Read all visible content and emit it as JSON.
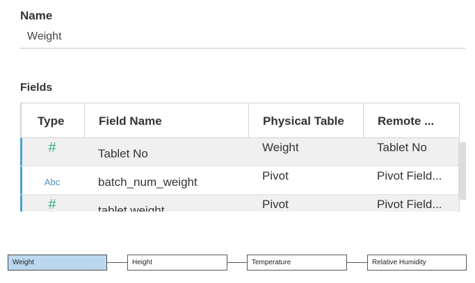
{
  "name_section": {
    "label": "Name",
    "value": "Weight"
  },
  "fields_section": {
    "label": "Fields",
    "columns": [
      "Type",
      "Field Name",
      "Physical Table",
      "Remote ..."
    ],
    "rows": [
      {
        "type_icon": "number-icon",
        "type_glyph": "#",
        "field_name": "Tablet No",
        "physical_table": "Weight",
        "remote": "Tablet No"
      },
      {
        "type_icon": "string-icon",
        "type_glyph": "Abc",
        "field_name": "batch_num_weight",
        "physical_table": "Pivot",
        "remote": "Pivot Field..."
      },
      {
        "type_icon": "number-icon",
        "type_glyph": "#",
        "field_name": "tablet weight",
        "physical_table": "Pivot",
        "remote": "Pivot Field..."
      }
    ]
  },
  "flow": {
    "nodes": [
      "Weight",
      "Height",
      "Temperature",
      "Relative Humidity"
    ],
    "active": "Weight"
  },
  "colors": {
    "accent": "#4a9fd8",
    "number_icon": "#39b07d",
    "string_icon": "#4a8fc4",
    "active_node": "#bcd8f0"
  }
}
